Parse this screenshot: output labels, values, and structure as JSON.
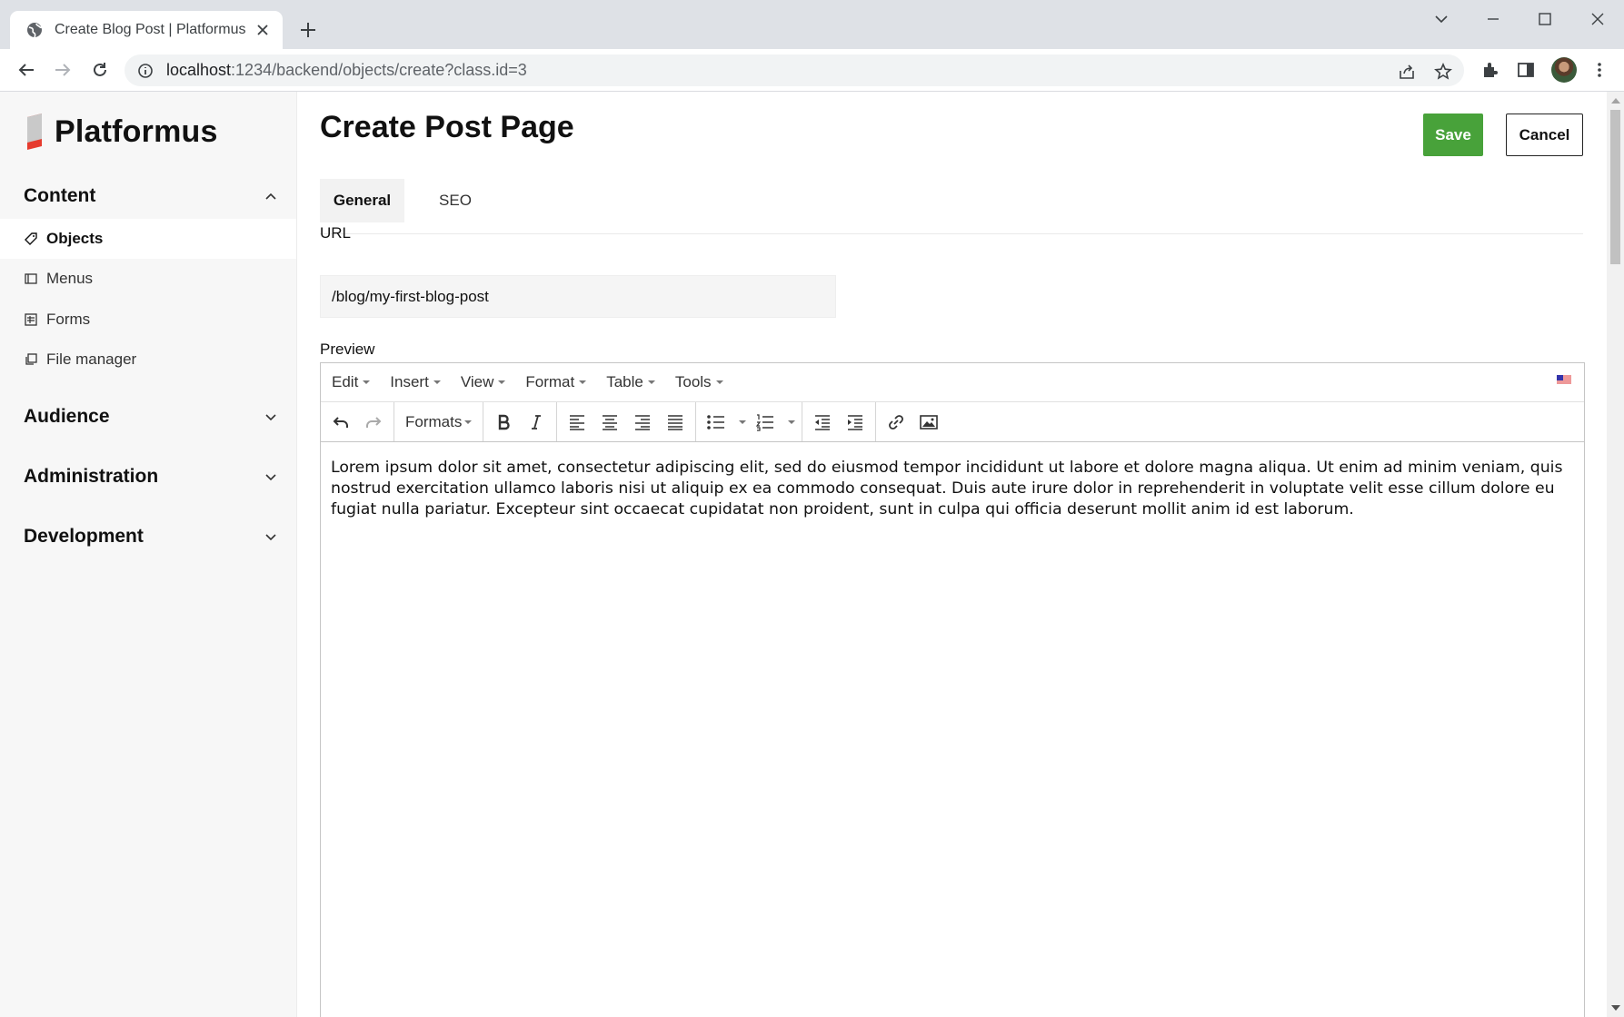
{
  "browser": {
    "tab_title": "Create Blog Post | Platformus",
    "url_host": "localhost",
    "url_rest": ":1234/backend/objects/create?class.id=3"
  },
  "sidebar": {
    "logo_text": "Platformus",
    "sections": [
      {
        "title": "Content",
        "expanded": true
      },
      {
        "title": "Audience",
        "expanded": false
      },
      {
        "title": "Administration",
        "expanded": false
      },
      {
        "title": "Development",
        "expanded": false
      }
    ],
    "items": [
      {
        "label": "Objects",
        "icon": "tag-icon",
        "active": true
      },
      {
        "label": "Menus",
        "icon": "menu-icon",
        "active": false
      },
      {
        "label": "Forms",
        "icon": "form-icon",
        "active": false
      },
      {
        "label": "File manager",
        "icon": "file-manager-icon",
        "active": false
      }
    ]
  },
  "main": {
    "title": "Create Post Page",
    "save_label": "Save",
    "cancel_label": "Cancel",
    "tabs": [
      {
        "label": "General",
        "active": true
      },
      {
        "label": "SEO",
        "active": false
      }
    ],
    "url_field": {
      "label": "URL",
      "value": "/blog/my-first-blog-post"
    },
    "preview_label": "Preview"
  },
  "editor": {
    "menus": [
      "Edit",
      "Insert",
      "View",
      "Format",
      "Table",
      "Tools"
    ],
    "formats_label": "Formats",
    "content": "Lorem ipsum dolor sit amet, consectetur adipiscing elit, sed do eiusmod tempor incididunt ut labore et dolore magna aliqua. Ut enim ad minim veniam, quis nostrud exercitation ullamco laboris nisi ut aliquip ex ea commodo consequat. Duis aute irure dolor in reprehenderit in voluptate velit esse cillum dolore eu fugiat nulla pariatur. Excepteur sint occaecat cupidatat non proident, sunt in culpa qui officia deserunt mollit anim id est laborum."
  },
  "colors": {
    "save_button": "#48a23a",
    "logo_red": "#e63b2e",
    "sidebar_bg": "#f7f7f7"
  }
}
